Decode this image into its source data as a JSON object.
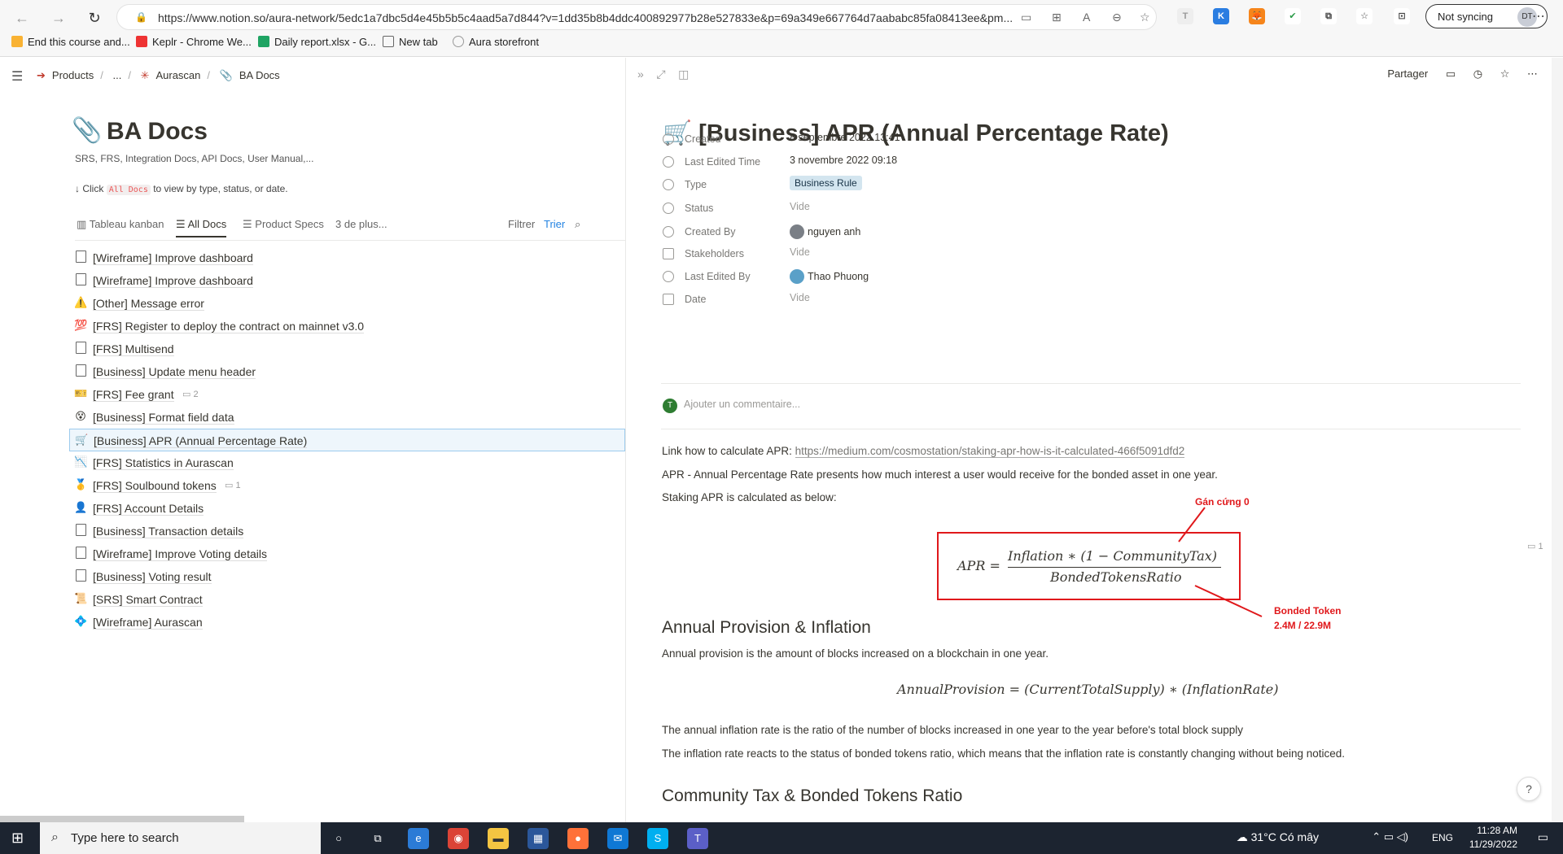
{
  "browser": {
    "url": "https://www.notion.so/aura-network/5edc1a7dbc5d4e45b5b5c4aad5a7d844?v=1dd35b8b4ddc400892977b28e527833e&p=69a349e667764d7aababc85fa08413ee&pm...",
    "sync_label": "Not syncing",
    "profile_initials": "DT",
    "bookmarks": [
      "End this course and...",
      "Keplr - Chrome We...",
      "Daily report.xlsx - G...",
      "New tab",
      "Aura storefront"
    ]
  },
  "breadcrumb": [
    "Products",
    "...",
    "Aurascan",
    "BA Docs"
  ],
  "database": {
    "title": "BA Docs",
    "description": "SRS, FRS, Integration Docs, API Docs, User Manual,...",
    "hint_prefix": "↓ Click",
    "hint_code": "All Docs",
    "hint_suffix": "to view by type, status, or date.",
    "views": [
      "Tableau kanban",
      "All Docs",
      "Product Specs",
      "3 de plus..."
    ],
    "filter_label": "Filtrer",
    "sort_label": "Trier",
    "items": [
      {
        "title": "[Wireframe] Improve dashboard",
        "icon": "page-icon",
        "comments": ""
      },
      {
        "title": "[Wireframe] Improve dashboard",
        "icon": "page-outline-icon",
        "comments": ""
      },
      {
        "title": "[Other] Message error",
        "icon": "warning-icon",
        "comments": ""
      },
      {
        "title": "[FRS] Register to deploy the contract on mainnet v3.0",
        "icon": "hundred-icon",
        "comments": ""
      },
      {
        "title": "[FRS] Multisend",
        "icon": "page-icon",
        "comments": ""
      },
      {
        "title": "[Business] Update menu header",
        "icon": "page-icon",
        "comments": ""
      },
      {
        "title": "[FRS] Fee grant",
        "icon": "ticket-icon",
        "comments": "2"
      },
      {
        "title": "[Business] Format field data",
        "icon": "emoji-icon",
        "comments": ""
      },
      {
        "title": "[Business] APR (Annual Percentage Rate)",
        "icon": "cart-icon",
        "comments": ""
      },
      {
        "title": "[FRS] Statistics in Aurascan",
        "icon": "chart-icon",
        "comments": ""
      },
      {
        "title": "[FRS] Soulbound tokens",
        "icon": "medal-icon",
        "comments": "1"
      },
      {
        "title": "[FRS] Account Details",
        "icon": "person-icon",
        "comments": ""
      },
      {
        "title": "[Business] Transaction details",
        "icon": "page-icon",
        "comments": ""
      },
      {
        "title": "[Wireframe] Improve Voting details",
        "icon": "page-icon",
        "comments": ""
      },
      {
        "title": "[Business] Voting result",
        "icon": "page-icon",
        "comments": ""
      },
      {
        "title": "[SRS] Smart Contract",
        "icon": "scroll-icon",
        "comments": ""
      },
      {
        "title": "[Wireframe] Aurascan",
        "icon": "diamond-icon",
        "comments": ""
      }
    ]
  },
  "page": {
    "share_label": "Partager",
    "title": "[Business] APR (Annual Percentage Rate)",
    "properties": [
      {
        "name": "Created",
        "value": "8 septembre 2022 13:41"
      },
      {
        "name": "Last Edited Time",
        "value": "3 novembre 2022 09:18"
      },
      {
        "name": "Type",
        "value": "Business Rule"
      },
      {
        "name": "Status",
        "value": "Vide"
      },
      {
        "name": "Created By",
        "value": "nguyen anh"
      },
      {
        "name": "Stakeholders",
        "value": "Vide"
      },
      {
        "name": "Last Edited By",
        "value": "Thao Phuong"
      },
      {
        "name": "Date",
        "value": "Vide"
      }
    ],
    "comment_avatar": "T",
    "comment_placeholder": "Ajouter un commentaire...",
    "link_prefix": "Link how to calculate APR: ",
    "link_url": "https://medium.com/cosmostation/staking-apr-how-is-it-calculated-466f5091dfd2",
    "p1": "APR - Annual Percentage Rate presents how much interest a user would receive for the bonded asset in one year.",
    "p2": "Staking APR is calculated as below:",
    "formula_lhs": "APR =",
    "formula_num": "Inflation ∗ (1 − CommunityTax)",
    "formula_den": "BondedTokensRatio",
    "annotation_top": "Gán cứng 0",
    "annotation_bottom_1": "Bonded Token",
    "annotation_bottom_2": "2.4M / 22.9M",
    "comment_count": "1",
    "h_annual": "Annual Provision & Inflation",
    "p_annual": "Annual provision is the amount of blocks increased on a blockchain in one year.",
    "formula2": "AnnualProvision = (CurrentTotalSupply) ∗ (InflationRate)",
    "p3": "The annual inflation rate is the ratio of the number of blocks increased in one year to the year before's total block supply",
    "p4": "The inflation rate reacts to the status of bonded tokens ratio, which means that the inflation rate is constantly changing without being noticed.",
    "h_community": "Community Tax & Bonded Tokens Ratio",
    "help": "?"
  },
  "taskbar": {
    "search_placeholder": "Type here to search",
    "weather": "31°C  Có mây",
    "lang": "ENG",
    "time": "11:28 AM",
    "date": "11/29/2022"
  }
}
